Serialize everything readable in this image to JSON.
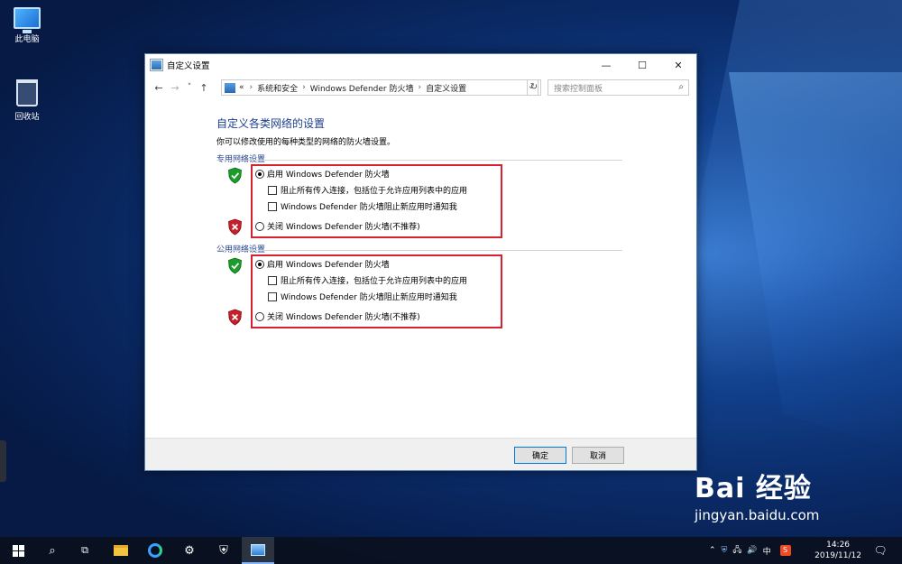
{
  "desktop": {
    "icons": [
      {
        "label": "此电脑",
        "icon": "computer-icon"
      },
      {
        "label": "回收站",
        "icon": "recycle-bin-icon"
      }
    ]
  },
  "window": {
    "title": "自定义设置",
    "controls": {
      "minimize": "—",
      "maximize": "☐",
      "close": "✕"
    },
    "nav": {
      "back": "←",
      "forward": "→",
      "recent": "˅",
      "up": "↑"
    },
    "breadcrumb": [
      "«",
      "系统和安全",
      "Windows Defender 防火墙",
      "自定义设置"
    ],
    "search_placeholder": "搜索控制面板",
    "heading": "自定义各类网络的设置",
    "description": "你可以修改使用的每种类型的网络的防火墙设置。",
    "groups": [
      {
        "title": "专用网络设置",
        "enable_label": "启用 Windows Defender 防火墙",
        "block_label": "阻止所有传入连接，包括位于允许应用列表中的应用",
        "notify_label": "Windows Defender 防火墙阻止新应用时通知我",
        "disable_label": "关闭 Windows Defender 防火墙(不推荐)",
        "selected": "enable"
      },
      {
        "title": "公用网络设置",
        "enable_label": "启用 Windows Defender 防火墙",
        "block_label": "阻止所有传入连接，包括位于允许应用列表中的应用",
        "notify_label": "Windows Defender 防火墙阻止新应用时通知我",
        "disable_label": "关闭 Windows Defender 防火墙(不推荐)",
        "selected": "enable"
      }
    ],
    "ok_label": "确定",
    "cancel_label": "取消"
  },
  "taskbar": {
    "tray_ime": "中",
    "time": "14:26",
    "date": "2019/11/12"
  },
  "watermark": {
    "brand": "Bai 经验",
    "url": "jingyan.baidu.com"
  },
  "colors": {
    "accent": "#1e3f8f",
    "highlight_box": "#d8212f",
    "shield_ok": "#1a9d2a",
    "shield_bad": "#c8202a"
  }
}
